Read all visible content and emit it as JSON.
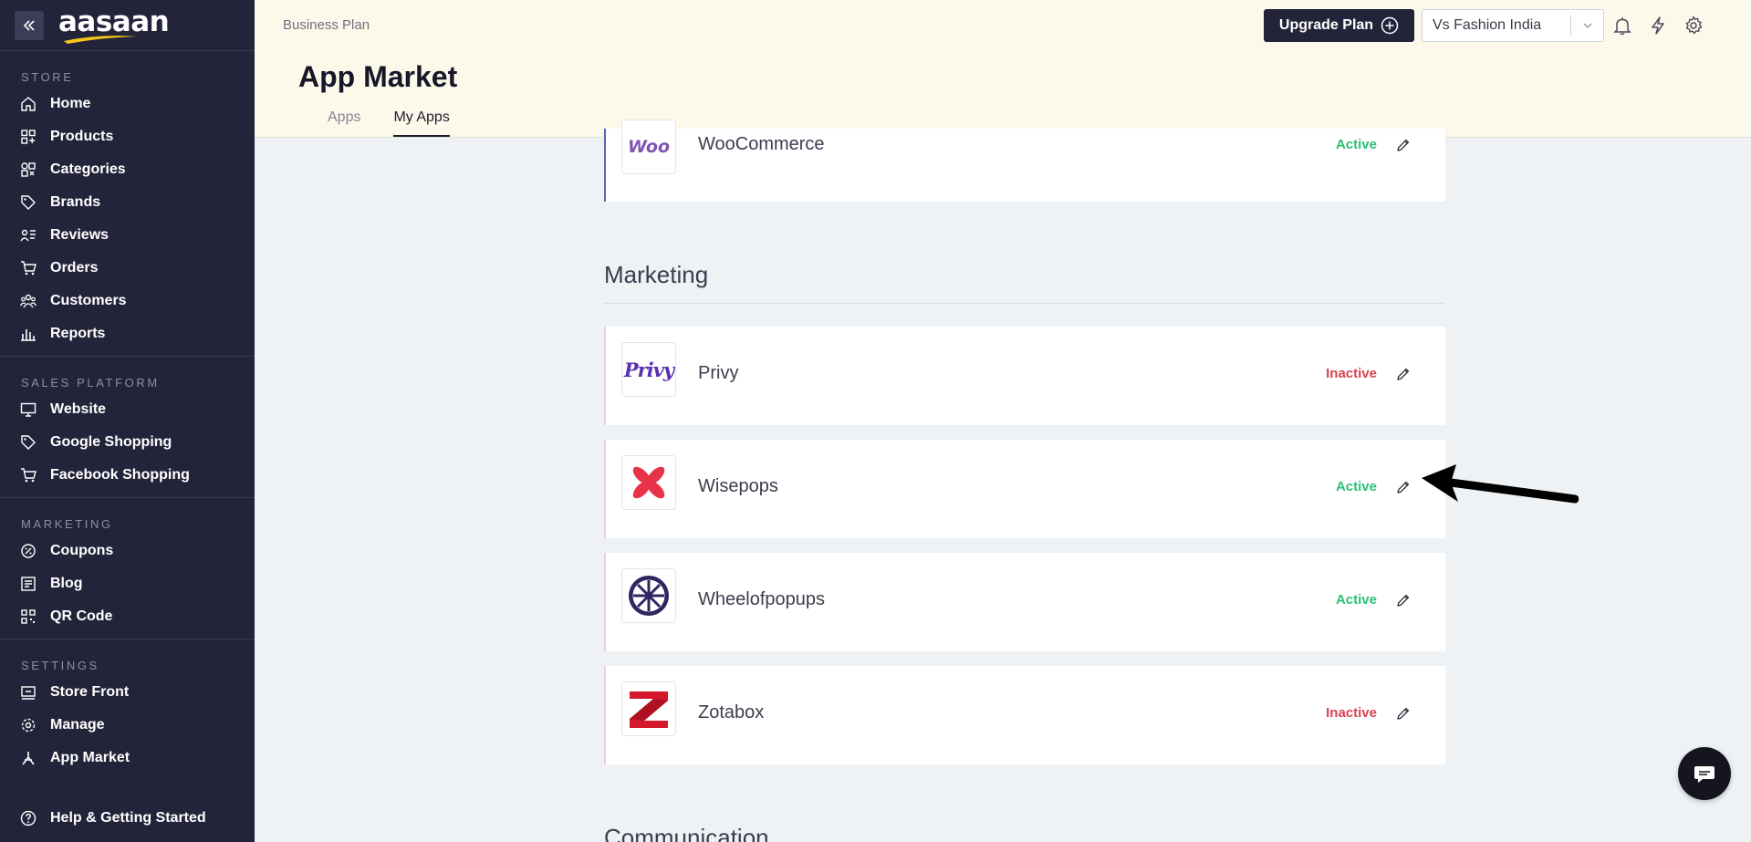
{
  "brand": {
    "logo_text": "aasaan"
  },
  "sidebar": {
    "sections": [
      {
        "title": "STORE",
        "items": [
          {
            "label": "Home",
            "icon": "home-icon"
          },
          {
            "label": "Products",
            "icon": "products-icon"
          },
          {
            "label": "Categories",
            "icon": "categories-icon"
          },
          {
            "label": "Brands",
            "icon": "tag-icon"
          },
          {
            "label": "Reviews",
            "icon": "reviews-icon"
          },
          {
            "label": "Orders",
            "icon": "cart-icon"
          },
          {
            "label": "Customers",
            "icon": "customers-icon"
          },
          {
            "label": "Reports",
            "icon": "reports-icon"
          }
        ]
      },
      {
        "title": "SALES PLATFORM",
        "items": [
          {
            "label": "Website",
            "icon": "monitor-icon"
          },
          {
            "label": "Google Shopping",
            "icon": "tag-icon"
          },
          {
            "label": "Facebook Shopping",
            "icon": "cart-icon"
          }
        ]
      },
      {
        "title": "MARKETING",
        "items": [
          {
            "label": "Coupons",
            "icon": "coupon-icon"
          },
          {
            "label": "Blog",
            "icon": "blog-icon"
          },
          {
            "label": "QR Code",
            "icon": "qr-code-icon"
          }
        ]
      },
      {
        "title": "SETTINGS",
        "items": [
          {
            "label": "Store Front",
            "icon": "store-front-icon"
          },
          {
            "label": "Manage",
            "icon": "gear-icon"
          },
          {
            "label": "App Market",
            "icon": "app-market-icon"
          }
        ]
      }
    ],
    "help": {
      "label": "Help & Getting Started",
      "icon": "help-icon"
    }
  },
  "header": {
    "plan_label": "Business Plan",
    "title": "App Market",
    "tabs": [
      {
        "label": "Apps",
        "active": false
      },
      {
        "label": "My Apps",
        "active": true
      }
    ],
    "upgrade_label": "Upgrade Plan",
    "store_select": {
      "value": "Vs Fashion India"
    }
  },
  "main": {
    "top_card": {
      "name": "WooCommerce",
      "status": "Active",
      "logo_text": "Woo"
    },
    "sections": [
      {
        "title": "Marketing",
        "apps": [
          {
            "name": "Privy",
            "status": "Inactive",
            "logo_text": "Privy"
          },
          {
            "name": "Wisepops",
            "status": "Active"
          },
          {
            "name": "Wheelofpopups",
            "status": "Active"
          },
          {
            "name": "Zotabox",
            "status": "Inactive"
          }
        ]
      },
      {
        "title": "Communication",
        "apps": []
      }
    ]
  },
  "colors": {
    "sidebar": "#23243a",
    "header": "#fdf9ea",
    "active": "#2bbf76",
    "inactive": "#d9424f"
  }
}
